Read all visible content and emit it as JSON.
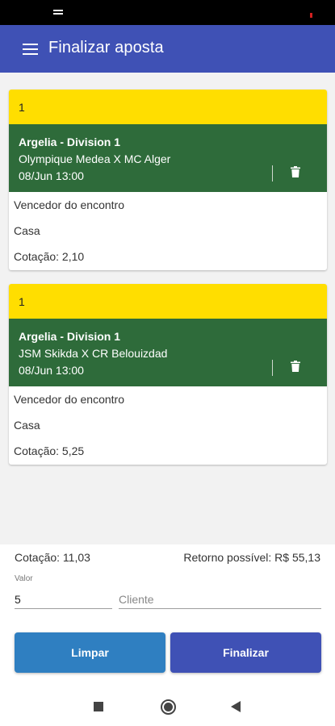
{
  "appbar": {
    "title": "Finalizar aposta"
  },
  "bets": [
    {
      "number": "1",
      "league": "Argelia - Division 1",
      "teams": "Olympique Medea X MC Alger",
      "datetime": "08/Jun 13:00",
      "market": "Vencedor do encontro",
      "selection": "Casa",
      "odds": "Cotação: 2,10"
    },
    {
      "number": "1",
      "league": "Argelia - Division 1",
      "teams": "JSM Skikda X CR Belouizdad",
      "datetime": "08/Jun 13:00",
      "market": "Vencedor do encontro",
      "selection": "Casa",
      "odds": "Cotação: 5,25"
    }
  ],
  "summary": {
    "total_odds": "Cotação: 11,03",
    "possible_return": "Retorno possível: R$ 55,13",
    "valor_label": "Valor",
    "valor_value": "5",
    "cliente_placeholder": "Cliente"
  },
  "buttons": {
    "clear": "Limpar",
    "finish": "Finalizar"
  },
  "icons": {
    "menu": "menu-icon",
    "trash": "trash-icon",
    "nav_recents": "recents-square-icon",
    "nav_home": "home-circle-icon",
    "nav_back": "back-triangle-icon"
  },
  "colors": {
    "appbar": "#3f51b5",
    "bet_header": "#ffde00",
    "match_panel": "#2e6b3a",
    "clear_button": "#2f7fc1",
    "finish_button": "#3f51b5"
  }
}
